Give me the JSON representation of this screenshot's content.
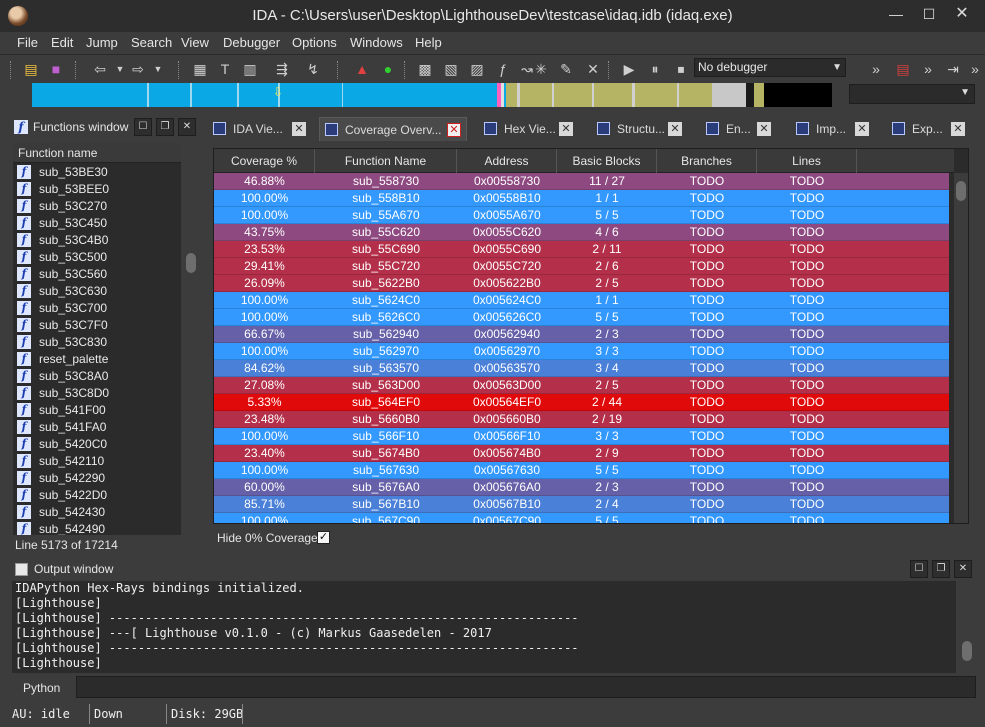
{
  "window": {
    "title": "IDA - C:\\Users\\user\\Desktop\\LighthouseDev\\testcase\\idaq.idb (idaq.exe)",
    "min_glyph": "—",
    "max_glyph": "☐",
    "close_glyph": "✕"
  },
  "menu": [
    "File",
    "Edit",
    "Jump",
    "Search",
    "View",
    "Debugger",
    "Options",
    "Windows",
    "Help"
  ],
  "toolbar": {
    "debugger_value": "No debugger",
    "icons": [
      "open-folder-icon",
      "save-icon",
      "back-arrow-icon",
      "forward-arrow-icon",
      "run-icon",
      "pause-icon",
      "stop-icon"
    ]
  },
  "functions_window": {
    "title": "Functions window",
    "column_header": "Function name",
    "items": [
      "sub_53BE30",
      "sub_53BEE0",
      "sub_53C270",
      "sub_53C450",
      "sub_53C4B0",
      "sub_53C500",
      "sub_53C560",
      "sub_53C630",
      "sub_53C700",
      "sub_53C7F0",
      "sub_53C830",
      "reset_palette",
      "sub_53C8A0",
      "sub_53C8D0",
      "sub_541F00",
      "sub_541FA0",
      "sub_5420C0",
      "sub_542110",
      "sub_542290",
      "sub_5422D0",
      "sub_542430",
      "sub_542490"
    ],
    "status": "Line 5173 of 17214"
  },
  "tabs": [
    {
      "label": "IDA Vie...",
      "active": false
    },
    {
      "label": "Coverage Overv...",
      "active": true
    },
    {
      "label": "Hex Vie...",
      "active": false
    },
    {
      "label": "Structu...",
      "active": false
    },
    {
      "label": "En...",
      "active": false
    },
    {
      "label": "Imp...",
      "active": false
    },
    {
      "label": "Exp...",
      "active": false
    }
  ],
  "coverage": {
    "columns": [
      "Coverage %",
      "Function Name",
      "Address",
      "Basic Blocks",
      "Branches",
      "Lines"
    ],
    "rows": [
      {
        "cov": "46.88%",
        "name": "sub_558730",
        "addr": "0x00558730",
        "bb": "11 / 27",
        "br": "TODO",
        "ln": "TODO",
        "color": "#8e4a80"
      },
      {
        "cov": "100.00%",
        "name": "sub_558B10",
        "addr": "0x00558B10",
        "bb": "1 / 1",
        "br": "TODO",
        "ln": "TODO",
        "color": "#3399ff"
      },
      {
        "cov": "100.00%",
        "name": "sub_55A670",
        "addr": "0x0055A670",
        "bb": "5 / 5",
        "br": "TODO",
        "ln": "TODO",
        "color": "#3399ff"
      },
      {
        "cov": "43.75%",
        "name": "sub_55C620",
        "addr": "0x0055C620",
        "bb": "4 / 6",
        "br": "TODO",
        "ln": "TODO",
        "color": "#8e4a80"
      },
      {
        "cov": "23.53%",
        "name": "sub_55C690",
        "addr": "0x0055C690",
        "bb": "2 / 11",
        "br": "TODO",
        "ln": "TODO",
        "color": "#b4304a"
      },
      {
        "cov": "29.41%",
        "name": "sub_55C720",
        "addr": "0x0055C720",
        "bb": "2 / 6",
        "br": "TODO",
        "ln": "TODO",
        "color": "#b4304a"
      },
      {
        "cov": "26.09%",
        "name": "sub_5622B0",
        "addr": "0x005622B0",
        "bb": "2 / 5",
        "br": "TODO",
        "ln": "TODO",
        "color": "#b4304a"
      },
      {
        "cov": "100.00%",
        "name": "sub_5624C0",
        "addr": "0x005624C0",
        "bb": "1 / 1",
        "br": "TODO",
        "ln": "TODO",
        "color": "#3399ff"
      },
      {
        "cov": "100.00%",
        "name": "sub_5626C0",
        "addr": "0x005626C0",
        "bb": "5 / 5",
        "br": "TODO",
        "ln": "TODO",
        "color": "#3399ff"
      },
      {
        "cov": "66.67%",
        "name": "sub_562940",
        "addr": "0x00562940",
        "bb": "2 / 3",
        "br": "TODO",
        "ln": "TODO",
        "color": "#6660a8"
      },
      {
        "cov": "100.00%",
        "name": "sub_562970",
        "addr": "0x00562970",
        "bb": "3 / 3",
        "br": "TODO",
        "ln": "TODO",
        "color": "#3399ff"
      },
      {
        "cov": "84.62%",
        "name": "sub_563570",
        "addr": "0x00563570",
        "bb": "3 / 4",
        "br": "TODO",
        "ln": "TODO",
        "color": "#4a80d8"
      },
      {
        "cov": "27.08%",
        "name": "sub_563D00",
        "addr": "0x00563D00",
        "bb": "2 / 5",
        "br": "TODO",
        "ln": "TODO",
        "color": "#b4304a"
      },
      {
        "cov": "5.33%",
        "name": "sub_564EF0",
        "addr": "0x00564EF0",
        "bb": "2 / 44",
        "br": "TODO",
        "ln": "TODO",
        "color": "#e00a0a"
      },
      {
        "cov": "23.48%",
        "name": "sub_5660B0",
        "addr": "0x005660B0",
        "bb": "2 / 19",
        "br": "TODO",
        "ln": "TODO",
        "color": "#b4304a"
      },
      {
        "cov": "100.00%",
        "name": "sub_566F10",
        "addr": "0x00566F10",
        "bb": "3 / 3",
        "br": "TODO",
        "ln": "TODO",
        "color": "#3399ff"
      },
      {
        "cov": "23.40%",
        "name": "sub_5674B0",
        "addr": "0x005674B0",
        "bb": "2 / 9",
        "br": "TODO",
        "ln": "TODO",
        "color": "#b4304a"
      },
      {
        "cov": "100.00%",
        "name": "sub_567630",
        "addr": "0x00567630",
        "bb": "5 / 5",
        "br": "TODO",
        "ln": "TODO",
        "color": "#3399ff"
      },
      {
        "cov": "60.00%",
        "name": "sub_5676A0",
        "addr": "0x005676A0",
        "bb": "2 / 3",
        "br": "TODO",
        "ln": "TODO",
        "color": "#6660a8"
      },
      {
        "cov": "85.71%",
        "name": "sub_567B10",
        "addr": "0x00567B10",
        "bb": "2 / 4",
        "br": "TODO",
        "ln": "TODO",
        "color": "#4a80d8"
      },
      {
        "cov": "100.00%",
        "name": "sub_567C90",
        "addr": "0x00567C90",
        "bb": "5 / 5",
        "br": "TODO",
        "ln": "TODO",
        "color": "#3399ff"
      }
    ],
    "hide_zero_label": "Hide 0% Coverage:",
    "hide_zero_checked": true,
    "check_glyph": "✓"
  },
  "output_window": {
    "title": "Output window",
    "lines": [
      "IDAPython Hex-Rays bindings initialized.",
      "[Lighthouse]",
      "[Lighthouse] -----------------------------------------------------------------",
      "[Lighthouse] ---[ Lighthouse v0.1.0 - (c) Markus Gaasedelen - 2017",
      "[Lighthouse] -----------------------------------------------------------------",
      "[Lighthouse]"
    ],
    "input_label": "Python"
  },
  "status_bar": {
    "au": "AU:  idle",
    "direction": "Down",
    "disk": "Disk: 29GB"
  }
}
